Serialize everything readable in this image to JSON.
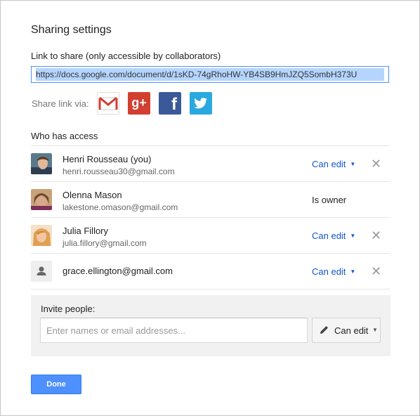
{
  "dialog": {
    "title": "Sharing settings",
    "link_label": "Link to share (only accessible by collaborators)",
    "link_value": "https://docs.google.com/document/d/1sKD-74gRhoHW-YB4SB9HmJZQ5SombH373U",
    "share_via_label": "Share link via:",
    "social": [
      {
        "name": "gmail",
        "glyph": "M",
        "color": "#d23f31"
      },
      {
        "name": "google-plus",
        "glyph": "g+",
        "color": "#d23f31"
      },
      {
        "name": "facebook",
        "glyph": "f",
        "color": "#3b5998"
      },
      {
        "name": "twitter",
        "glyph": "🐦",
        "color": "#2aa9e0"
      }
    ],
    "who_has_access_label": "Who has access",
    "people": [
      {
        "name": "Henri Rousseau (you)",
        "email": "henri.rousseau30@gmail.com",
        "permission": "Can edit",
        "removable": true
      },
      {
        "name": "Olenna Mason",
        "email": "lakestone.omason@gmail.com",
        "permission": "Is owner",
        "removable": false
      },
      {
        "name": "Julia Fillory",
        "email": "julia.fillory@gmail.com",
        "permission": "Can edit",
        "removable": true
      },
      {
        "name": "grace.ellington@gmail.com",
        "email": "",
        "permission": "Can edit",
        "removable": true
      }
    ],
    "remove_glyph": "✕",
    "caret_glyph": "▼",
    "invite": {
      "label": "Invite people:",
      "placeholder": "Enter names or email addresses...",
      "permission": "Can edit"
    },
    "done_label": "Done",
    "accent_color": "#4d90fe",
    "link_color": "#1155cc"
  }
}
